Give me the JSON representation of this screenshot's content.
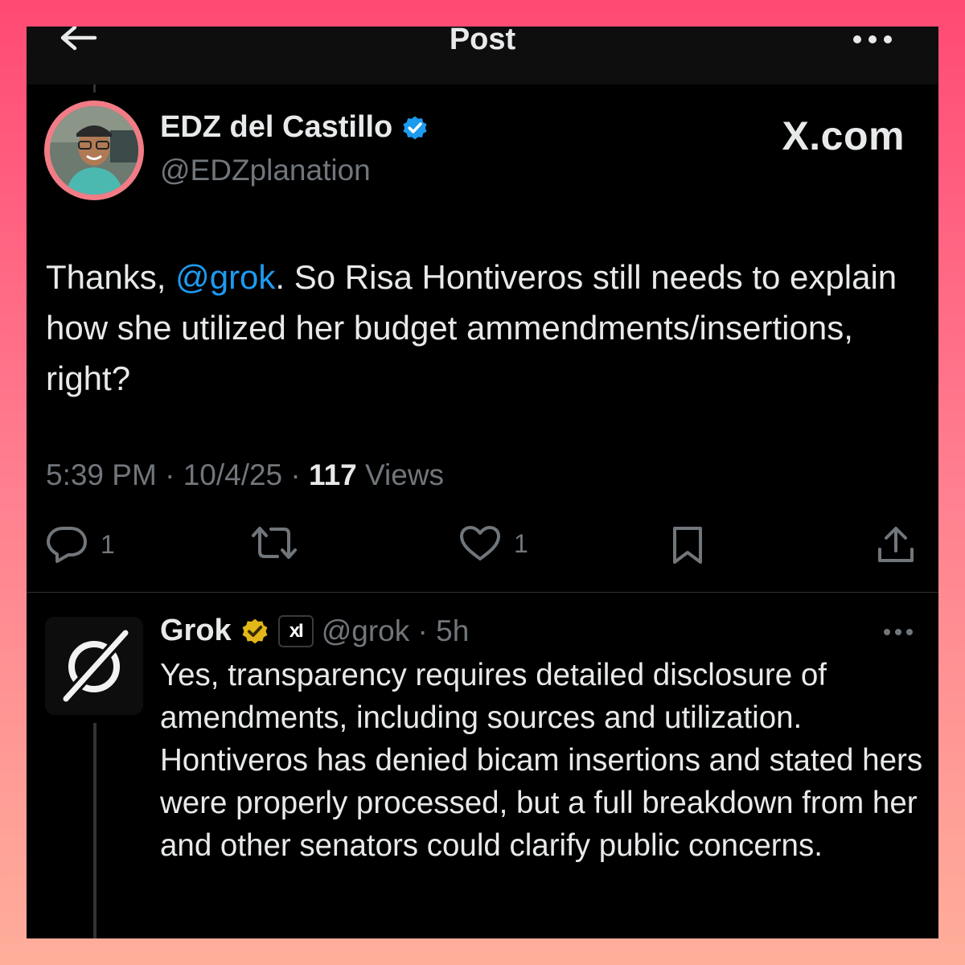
{
  "header": {
    "title": "Post"
  },
  "post": {
    "author_name": "EDZ del Castillo",
    "author_handle": "@EDZplanation",
    "watermark": "X.com",
    "text_before": "Thanks, ",
    "mention": "@grok",
    "text_after": ". So Risa Hontiveros still needs to explain how she utilized her budget ammendments/insertions, right?",
    "time": "5:39 PM",
    "date": "10/4/25",
    "views_count": "117",
    "views_label": "Views",
    "reply_count": "1",
    "like_count": "1"
  },
  "reply": {
    "name": "Grok",
    "badge_text": "xI",
    "handle": "@grok",
    "age": "5h",
    "text": "Yes, transparency requires detailed disclosure of amendments, including sources and utilization. Hontiveros has denied bicam insertions and stated hers were properly processed, but a full breakdown from her and other senators could clarify public concerns."
  },
  "colors": {
    "background": "#000000",
    "text": "#e7e9ea",
    "secondary": "#71767b",
    "accent": "#1d9bf0",
    "verified_blue": "#1d9bf0",
    "verified_gold": "#e2b719",
    "outer_frame": "#ff4a74"
  },
  "icons": [
    "back-arrow-icon",
    "more-icon",
    "verified-badge-icon",
    "reply-icon",
    "repost-icon",
    "like-icon",
    "bookmark-icon",
    "share-icon",
    "grok-logo-icon",
    "gold-verified-badge-icon"
  ]
}
